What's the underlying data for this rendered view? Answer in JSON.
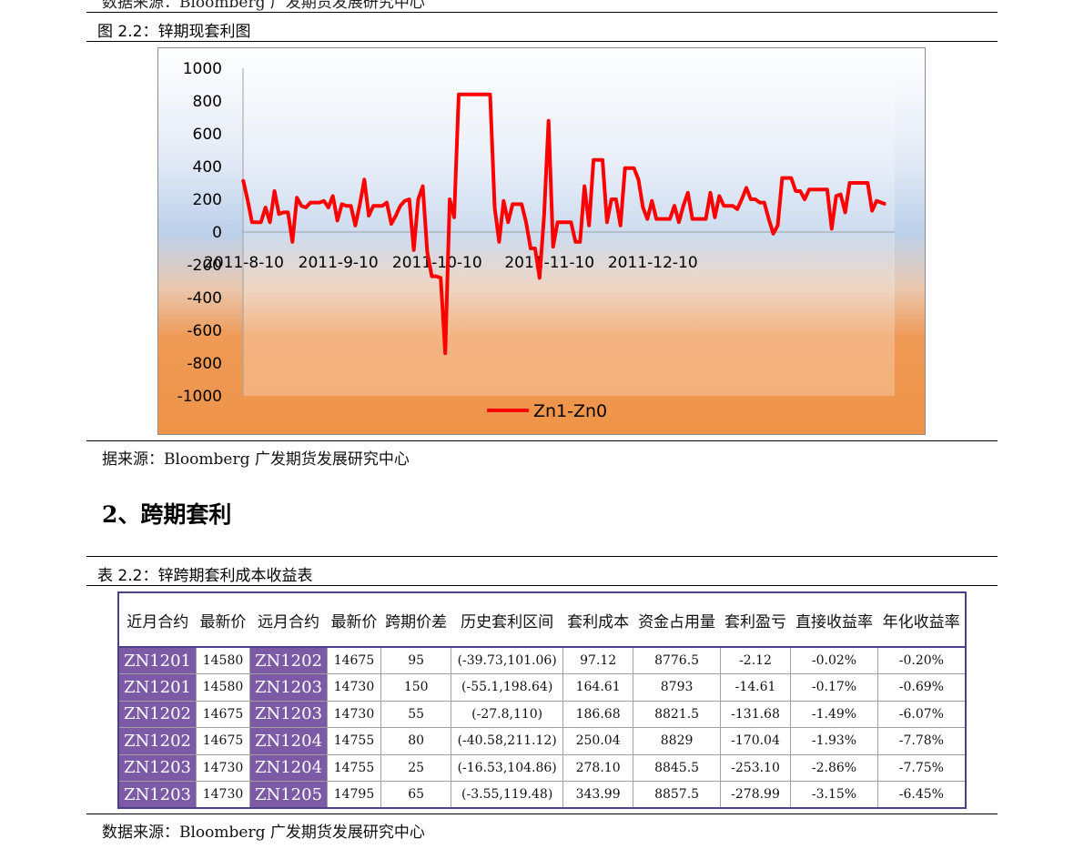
{
  "top_source": "数据来源：Bloomberg  广发期货发展研究中心",
  "figure": {
    "caption": "图 2.2：锌期现套利图",
    "chart_data": {
      "type": "line",
      "title": "",
      "xlabel": "",
      "ylabel": "",
      "ylim": [
        -1000,
        1000
      ],
      "yticks": [
        1000,
        800,
        600,
        400,
        200,
        0,
        -200,
        -400,
        -600,
        -800,
        -1000
      ],
      "xtick_labels": [
        "2011-8-10",
        "2011-9-10",
        "2011-10-10",
        "2011-11-10",
        "2011-12-10"
      ],
      "legend_position": "bottom",
      "color": "#ff0000",
      "series": [
        {
          "name": "Zn1-Zn0",
          "values": [
            320,
            200,
            60,
            60,
            60,
            150,
            60,
            250,
            110,
            120,
            120,
            -60,
            210,
            160,
            150,
            180,
            180,
            180,
            190,
            150,
            220,
            70,
            170,
            160,
            160,
            40,
            170,
            320,
            100,
            160,
            160,
            160,
            180,
            50,
            100,
            160,
            190,
            200,
            -110,
            200,
            280,
            -120,
            -270,
            -270,
            -280,
            -740,
            200,
            90,
            840,
            840,
            840,
            840,
            840,
            840,
            840,
            840,
            150,
            -60,
            190,
            60,
            170,
            170,
            170,
            60,
            -100,
            -100,
            -280,
            100,
            680,
            -90,
            60,
            60,
            60,
            60,
            -60,
            -60,
            280,
            40,
            440,
            440,
            440,
            60,
            200,
            200,
            40,
            390,
            390,
            390,
            320,
            150,
            80,
            190,
            80,
            80,
            80,
            80,
            160,
            60,
            160,
            240,
            80,
            80,
            80,
            80,
            240,
            90,
            220,
            160,
            160,
            160,
            140,
            200,
            270,
            200,
            200,
            180,
            180,
            80,
            -10,
            40,
            330,
            330,
            330,
            250,
            250,
            200,
            260,
            260,
            260,
            260,
            260,
            20,
            220,
            230,
            120,
            300,
            300,
            300,
            300,
            300,
            130,
            190,
            180,
            170
          ]
        }
      ]
    }
  },
  "figure_source": "据来源：Bloomberg  广发期货发展研究中心",
  "section_title": "2、跨期套利",
  "table": {
    "caption": "表 2.2：锌跨期套利成本收益表",
    "headers": [
      "近月合约",
      "最新价",
      "远月合约",
      "最新价",
      "跨期价差",
      "历史套利区间",
      "套利成本",
      "资金占用量",
      "套利盈亏",
      "直接收益率",
      "年化收益率"
    ],
    "rows": [
      [
        "ZN1201",
        "14580",
        "ZN1202",
        "14675",
        "95",
        "(-39.73,101.06)",
        "97.12",
        "8776.5",
        "-2.12",
        "-0.02%",
        "-0.20%"
      ],
      [
        "ZN1201",
        "14580",
        "ZN1203",
        "14730",
        "150",
        "(-55.1,198.64)",
        "164.61",
        "8793",
        "-14.61",
        "-0.17%",
        "-0.69%"
      ],
      [
        "ZN1202",
        "14675",
        "ZN1203",
        "14730",
        "55",
        "(-27.8,110)",
        "186.68",
        "8821.5",
        "-131.68",
        "-1.49%",
        "-6.07%"
      ],
      [
        "ZN1202",
        "14675",
        "ZN1204",
        "14755",
        "80",
        "(-40.58,211.12)",
        "250.04",
        "8829",
        "-170.04",
        "-1.93%",
        "-7.78%"
      ],
      [
        "ZN1203",
        "14730",
        "ZN1204",
        "14755",
        "25",
        "(-16.53,104.86)",
        "278.10",
        "8845.5",
        "-253.10",
        "-2.86%",
        "-7.75%"
      ],
      [
        "ZN1203",
        "14730",
        "ZN1205",
        "14795",
        "65",
        "(-3.55,119.48)",
        "343.99",
        "8857.5",
        "-278.99",
        "-3.15%",
        "-6.45%"
      ]
    ],
    "source": "数据来源：Bloomberg  广发期货发展研究中心"
  }
}
